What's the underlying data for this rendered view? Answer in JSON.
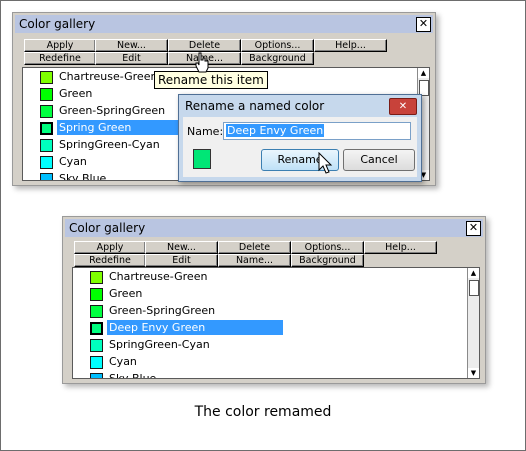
{
  "toolbar": {
    "apply": "Apply",
    "new": "New...",
    "delete": "Delete",
    "options": "Options...",
    "help": "Help...",
    "redefine": "Redefine",
    "edit": "Edit",
    "name": "Name...",
    "background": "Background"
  },
  "gallery_top": {
    "title": "Color gallery",
    "colors": [
      {
        "label": "Chartreuse-Green",
        "color": "#7fff00"
      },
      {
        "label": "Green",
        "color": "#00ff00"
      },
      {
        "label": "Green-SpringGreen",
        "color": "#00ff40"
      },
      {
        "label": "Spring Green",
        "color": "#00ff7f",
        "selected": true
      },
      {
        "label": "SpringGreen-Cyan",
        "color": "#00ffbf"
      },
      {
        "label": "Cyan",
        "color": "#00ffff"
      },
      {
        "label": "Sky Blue",
        "color": "#00bfff"
      }
    ]
  },
  "gallery_bottom": {
    "title": "Color gallery",
    "colors": [
      {
        "label": "Chartreuse-Green",
        "color": "#7fff00"
      },
      {
        "label": "Green",
        "color": "#00ff00"
      },
      {
        "label": "Green-SpringGreen",
        "color": "#00ff40"
      },
      {
        "label": "Deep Envy Green",
        "color": "#00ff7f",
        "selected": true
      },
      {
        "label": "SpringGreen-Cyan",
        "color": "#00ffbf"
      },
      {
        "label": "Cyan",
        "color": "#00ffff"
      },
      {
        "label": "Sky Blue",
        "color": "#00bfff"
      }
    ]
  },
  "tooltip": "Rename this item",
  "dialog": {
    "title": "Rename a named color",
    "name_label": "Name:",
    "name_value": "Deep Envy Green",
    "rename_button": "Rename",
    "cancel_button": "Cancel",
    "swatch_color": "#00e676"
  },
  "caption": "The color remamed"
}
